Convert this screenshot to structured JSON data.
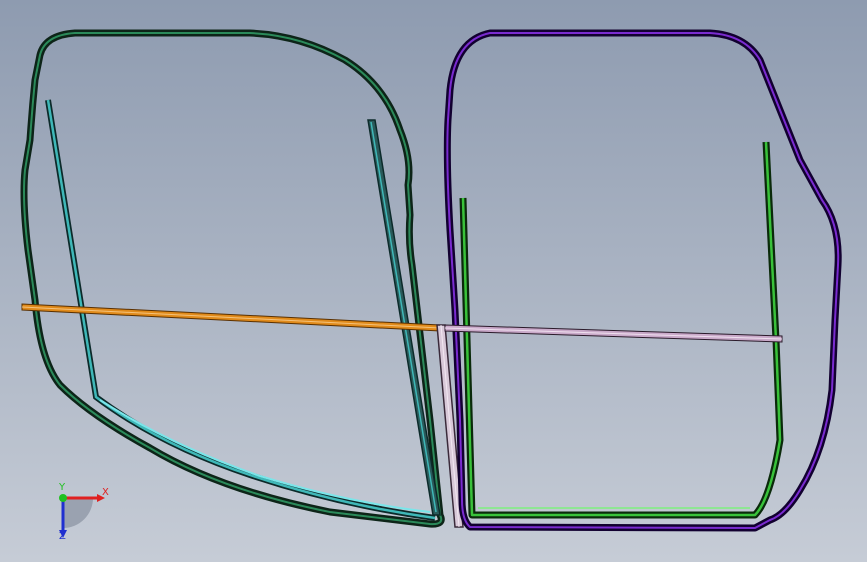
{
  "viewport": {
    "background_top": "#8e9bb0",
    "background_bottom": "#c6ccd6"
  },
  "parts": {
    "left_door_frame_color": "#2b8a5a",
    "left_glass_run_color": "#3fb8b8",
    "left_beltline_color": "#e08a1a",
    "right_door_frame_color": "#7a2bd0",
    "right_glass_run_color": "#39c23a",
    "right_beltline_color": "#c9a9c9",
    "center_pillar_color": "#d8c8d8"
  },
  "triad": {
    "x_label": "X",
    "y_label": "Y",
    "z_label": "Z",
    "x_color": "#e02020",
    "y_color": "#20c020",
    "z_color": "#2030d0"
  }
}
